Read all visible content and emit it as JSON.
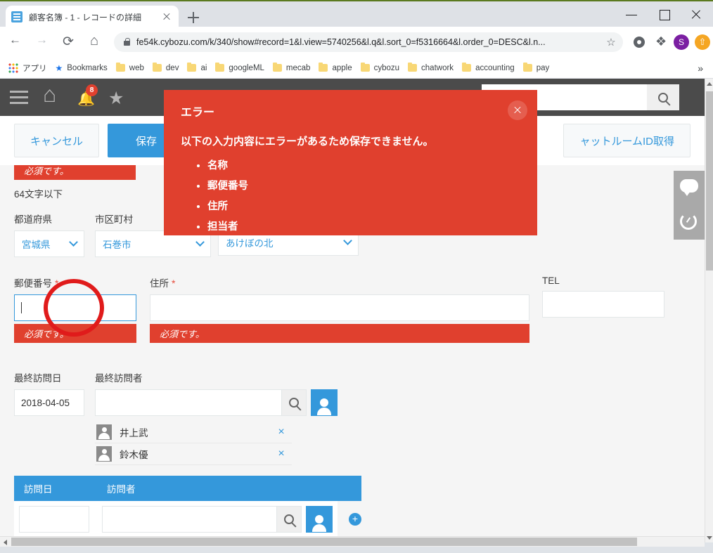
{
  "browser": {
    "tab": {
      "title": "顧客名簿 - 1 - レコードの詳細",
      "favicon": "app-icon",
      "close": "×"
    },
    "new_tab_label": "+",
    "window_controls": {
      "minimize": "—",
      "maximize": "□",
      "close": "×"
    },
    "url": "fe54k.cybozu.com/k/340/show#record=1&l.view=5740256&l.q&l.sort_0=f5316664&l.order_0=DESC&l.n...",
    "nav": {
      "back": "←",
      "forward": "→",
      "reload": "⟳",
      "home": "⌂"
    },
    "toolbar_icons": [
      "bookmark-star-icon",
      "gear-icon",
      "extensions-puzzle-icon",
      "profile-avatar",
      "upload-icon"
    ],
    "profile_initial": "S",
    "bookmarks": [
      {
        "label": "アプリ",
        "icon": "apps-grid-icon"
      },
      {
        "label": "Bookmarks",
        "icon": "star-icon"
      },
      {
        "label": "web",
        "icon": "folder-icon"
      },
      {
        "label": "dev",
        "icon": "folder-icon"
      },
      {
        "label": "ai",
        "icon": "folder-icon"
      },
      {
        "label": "googleML",
        "icon": "folder-icon"
      },
      {
        "label": "mecab",
        "icon": "folder-icon"
      },
      {
        "label": "apple",
        "icon": "folder-icon"
      },
      {
        "label": "cybozu",
        "icon": "folder-icon"
      },
      {
        "label": "chatwork",
        "icon": "folder-icon"
      },
      {
        "label": "accounting",
        "icon": "folder-icon"
      },
      {
        "label": "pay",
        "icon": "folder-icon"
      }
    ],
    "bookmarks_overflow": "»"
  },
  "app_header": {
    "icons": [
      "hamburger-menu-icon",
      "home-icon",
      "notification-bell-icon",
      "favorite-star-icon"
    ],
    "notification_count": "8",
    "search_placeholder": "検索",
    "search_value": ""
  },
  "action_bar": {
    "cancel_label": "キャンセル",
    "save_label": "保存",
    "chat_room_id_label": "ャットルームID取得"
  },
  "form": {
    "top_error": "必須です。",
    "name_hint": "64文字以下",
    "prefecture": {
      "label": "都道府県",
      "value": "宮城県"
    },
    "city": {
      "label": "市区町村",
      "value": "石巻市"
    },
    "town": {
      "label": "",
      "value": "あけぼの北"
    },
    "postal_code": {
      "label": "郵便番号",
      "required": "*",
      "value": "",
      "error": "必須です。"
    },
    "address": {
      "label": "住所",
      "required": "*",
      "value": "",
      "error": "必須です。"
    },
    "tel": {
      "label": "TEL",
      "value": ""
    },
    "last_visit_date": {
      "label": "最終訪問日",
      "value": "2018-04-05"
    },
    "last_visitor": {
      "label": "最終訪問者",
      "search_value": "",
      "selected": [
        {
          "name": "井上武",
          "remove": "×"
        },
        {
          "name": "鈴木優",
          "remove": "×"
        }
      ]
    },
    "visit_table": {
      "columns": [
        "訪問日",
        "訪問者"
      ],
      "rows": [
        {
          "date": "",
          "visitor": ""
        }
      ],
      "add_row_label": "+"
    }
  },
  "right_rail": {
    "icons": [
      "comment-bubble-icon",
      "history-clock-icon"
    ]
  },
  "dialog": {
    "title": "エラー",
    "message": "以下の入力内容にエラーがあるため保存できません。",
    "items": [
      "名称",
      "郵便番号",
      "住所",
      "担当者"
    ],
    "close_label": "×",
    "color": "#e0402e"
  },
  "colors": {
    "accent_blue": "#3498db",
    "error_red": "#e0402e",
    "header_dark": "#4b4b4b",
    "annotation_red": "#e01b1b"
  }
}
